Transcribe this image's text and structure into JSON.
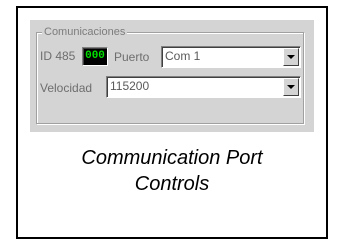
{
  "group": {
    "legend": "Comunicaciones",
    "id_label": "ID 485",
    "id_value": "000",
    "port_label": "Puerto",
    "port_value": "Com 1",
    "speed_label": "Velocidad",
    "speed_value": "115200"
  },
  "caption": {
    "line1": "Communication Port",
    "line2": "Controls"
  },
  "colors": {
    "panel_bg": "#d4d4d4",
    "led_bg": "#000000",
    "led_text": "#00e000"
  },
  "icons": {
    "dropdown": "chevron-down-icon"
  }
}
